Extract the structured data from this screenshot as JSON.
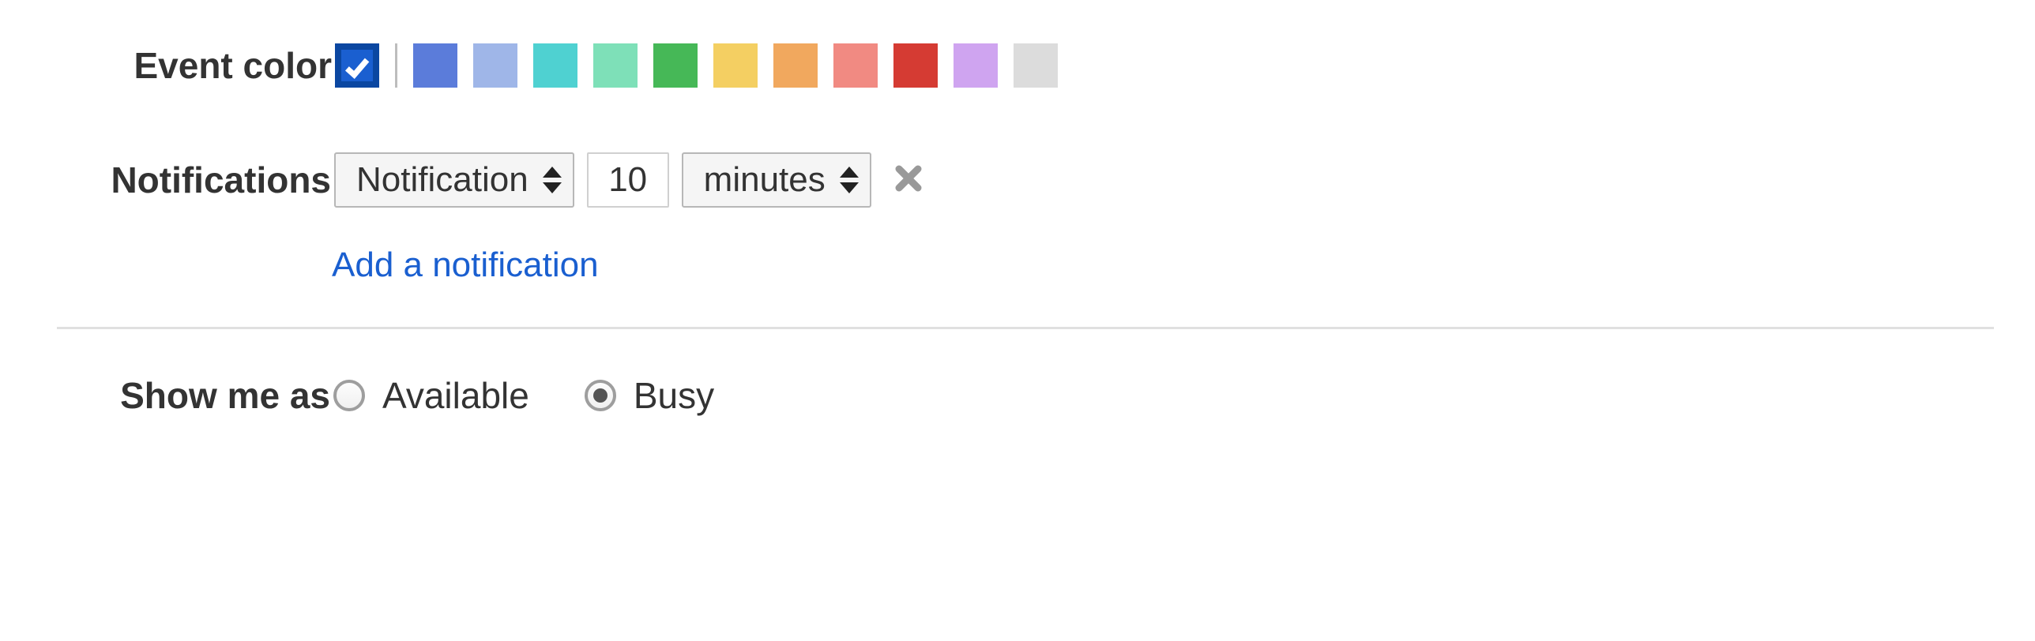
{
  "event_color": {
    "label": "Event color",
    "selected_index": 0,
    "colors": [
      "#1a5fd0",
      "#5b7cda",
      "#9fb6e8",
      "#4fd1d1",
      "#7ee0b8",
      "#46b857",
      "#f4cf62",
      "#f1a85e",
      "#f18a82",
      "#d53b33",
      "#cfa4f0",
      "#dcdcdc"
    ]
  },
  "notifications": {
    "label": "Notifications",
    "type_label": "Notification",
    "value": "10",
    "unit_label": "minutes",
    "add_label": "Add a notification"
  },
  "show_me_as": {
    "label": "Show me as",
    "options": [
      {
        "label": "Available",
        "checked": false
      },
      {
        "label": "Busy",
        "checked": true
      }
    ]
  }
}
